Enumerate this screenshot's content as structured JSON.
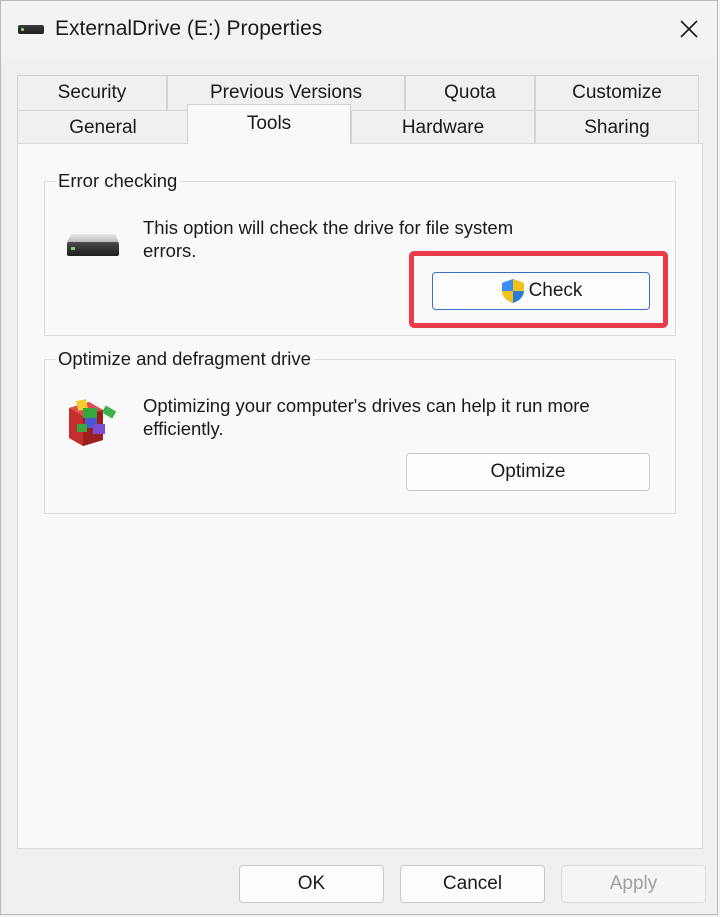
{
  "window": {
    "title": "ExternalDrive (E:) Properties"
  },
  "tabs": {
    "row1": [
      "Security",
      "Previous Versions",
      "Quota",
      "Customize"
    ],
    "row2": [
      "General",
      "Tools",
      "Hardware",
      "Sharing"
    ],
    "active": "Tools"
  },
  "error_checking": {
    "title": "Error checking",
    "description_line1": "This option will check the drive for file system",
    "description_line2": "errors.",
    "button_label": "Check",
    "icon": "drive-icon",
    "button_icon": "uac-shield-icon"
  },
  "optimize": {
    "title": "Optimize and defragment drive",
    "description_line1": "Optimizing your computer's drives can help it run more",
    "description_line2": "efficiently.",
    "button_label": "Optimize",
    "icon": "defrag-icon"
  },
  "footer": {
    "ok_label": "OK",
    "cancel_label": "Cancel",
    "apply_label": "Apply"
  },
  "colors": {
    "highlight": "#ea3a4c",
    "primary_border": "#3b6ec7"
  }
}
